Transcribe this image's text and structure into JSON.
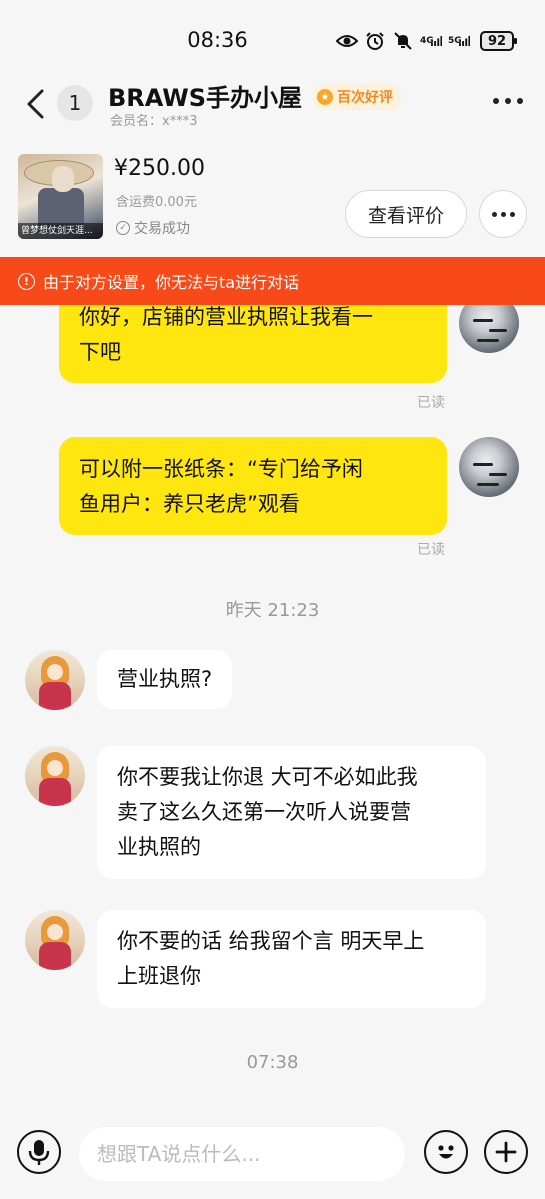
{
  "status_bar": {
    "time": "08:36",
    "net1": "4G",
    "net2": "5G",
    "battery": "92",
    "icons": [
      "eye-comfort-icon",
      "alarm-icon",
      "mute-icon",
      "signal-4g-icon",
      "signal-5g-icon",
      "battery-icon"
    ]
  },
  "header": {
    "back_icon": "chevron-left-icon",
    "unread_count": "1",
    "shop_name": "BRAWS手办小屋",
    "rating_badge": "百次好评",
    "member_label": "会员名：x***3",
    "more_icon": "more-dots-icon"
  },
  "product": {
    "price": "¥250.00",
    "shipping": "含运费0.00元",
    "status": "交易成功",
    "thumb_caption": "曾梦想仗剑天涯...",
    "review_button": "查看评价"
  },
  "banner": {
    "text": "由于对方设置，你无法与ta进行对话",
    "color": "#f84a18"
  },
  "messages": [
    {
      "side": "me",
      "text": "你好，店铺的营业执照让我看一下吧",
      "lines": [
        "你好，店铺的营业执照让我看一",
        "下吧"
      ],
      "status": "已读"
    },
    {
      "side": "me",
      "text": "可以附一张纸条：“专门给予闲鱼用户：养只老虎”观看",
      "lines": [
        "可以附一张纸条：“专门给予闲",
        "鱼用户：养只老虎”观看"
      ],
      "status": "已读"
    },
    {
      "side": "divider",
      "text": "昨天 21:23"
    },
    {
      "side": "them",
      "text": "营业执照?",
      "lines": [
        "营业执照?"
      ]
    },
    {
      "side": "them",
      "text": "你不要我让你退 大可不必如此我卖了这么久还第一次听人说要营业执照的",
      "lines": [
        "你不要我让你退 大可不必如此我",
        "卖了这么久还第一次听人说要营",
        "业执照的"
      ]
    },
    {
      "side": "them",
      "text": "你不要的话 给我留个言 明天早上上班退你",
      "lines": [
        "你不要的话 给我留个言 明天早上",
        "上班退你"
      ]
    },
    {
      "side": "divider",
      "text": "07:38"
    }
  ],
  "input_bar": {
    "placeholder": "想跟TA说点什么...",
    "value": "",
    "icons": [
      "microphone-icon",
      "emoji-icon",
      "add-icon"
    ]
  },
  "colors": {
    "my_bubble": "#ffe60f",
    "their_bubble": "#ffffff",
    "background": "#f6f6f6",
    "rating_text": "#f08a1e"
  }
}
